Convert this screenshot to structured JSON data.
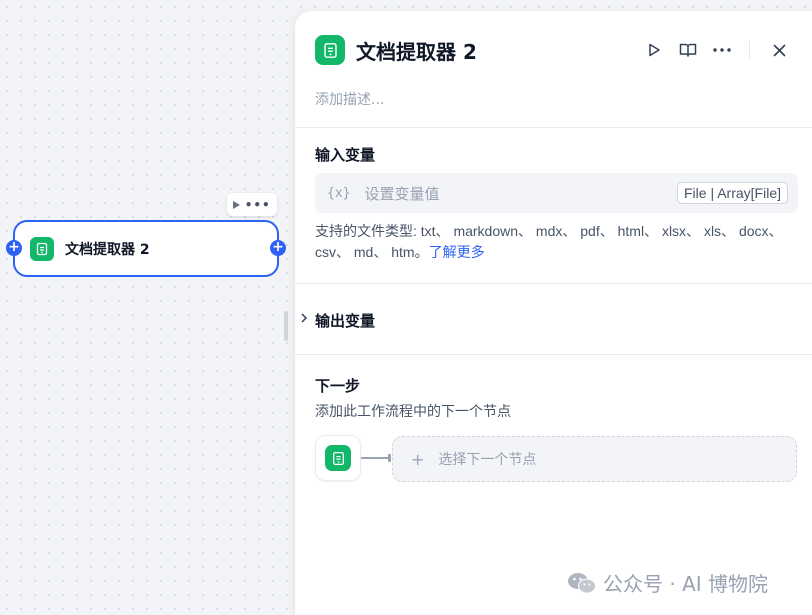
{
  "canvas": {
    "node": {
      "title": "文档提取器 2"
    },
    "icons": [
      "run-icon",
      "more-icon",
      "doc-extractor-icon",
      "add-handle-icon"
    ]
  },
  "panel": {
    "title": "文档提取器 2",
    "description_placeholder": "添加描述...",
    "header_icons": [
      "run-icon",
      "book-icon",
      "more-icon",
      "close-icon"
    ],
    "input": {
      "section_title": "输入变量",
      "var_icon": "{x}",
      "placeholder": "设置变量值",
      "type_badge": "File | Array[File]",
      "support_text": "支持的文件类型: txt、 markdown、 mdx、 pdf、 html、 xlsx、 xls、 docx、 csv、 md、 htm。",
      "learn_more": "了解更多"
    },
    "output": {
      "section_title": "输出变量"
    },
    "next_step": {
      "title": "下一步",
      "subtitle": "添加此工作流程中的下一个节点",
      "select_label": "选择下一个节点"
    }
  },
  "watermark": {
    "text": "公众号 · AI 博物院"
  },
  "colors": {
    "accent": "#2e62f5",
    "node_green": "#12b76a",
    "muted": "#98a2b3"
  }
}
